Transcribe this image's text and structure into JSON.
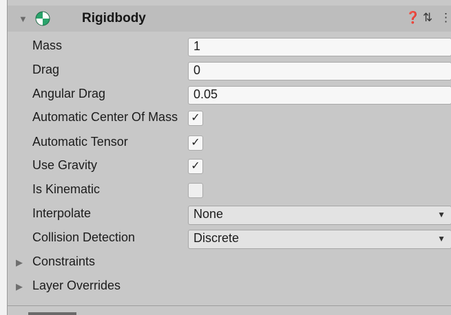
{
  "component": {
    "title": "Rigidbody",
    "icon": "rigidbody-icon",
    "fold_icon": "▼",
    "help_icon": "❓",
    "preset_icon": "⇅",
    "menu_icon": "⋮"
  },
  "fields": {
    "mass": {
      "label": "Mass",
      "value": "1"
    },
    "drag": {
      "label": "Drag",
      "value": "0"
    },
    "angular_drag": {
      "label": "Angular Drag",
      "value": "0.05"
    },
    "auto_center_of_mass": {
      "label": "Automatic Center Of Mass",
      "checked": true,
      "mark": "✓"
    },
    "auto_tensor": {
      "label": "Automatic Tensor",
      "checked": true,
      "mark": "✓"
    },
    "use_gravity": {
      "label": "Use Gravity",
      "checked": true,
      "mark": "✓"
    },
    "is_kinematic": {
      "label": "Is Kinematic",
      "checked": false,
      "mark": ""
    },
    "interpolate": {
      "label": "Interpolate",
      "value": "None"
    },
    "collision_detection": {
      "label": "Collision Detection",
      "value": "Discrete"
    }
  },
  "foldouts": {
    "constraints": {
      "label": "Constraints"
    },
    "layer_overrides": {
      "label": "Layer Overrides"
    }
  },
  "colors": {
    "panel_bg": "#c8c8c8",
    "header_bg": "#bdbdbd",
    "field_bg": "#f7f7f7",
    "dropdown_bg": "#e3e3e3",
    "icon_green": "#2aa36b"
  }
}
